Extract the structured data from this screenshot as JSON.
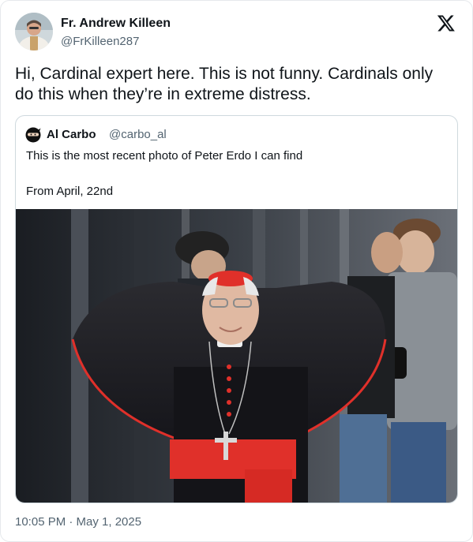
{
  "author": {
    "name": "Fr. Andrew Killeen",
    "handle": "@FrKilleen287",
    "avatar_icon": "profile-avatar"
  },
  "platform_icon": "x-logo-icon",
  "tweet": {
    "text_line1": "Hi, Cardinal expert here. This is not funny. Cardinals only",
    "text_line2": "do this when they’re in extreme distress."
  },
  "quoted_tweet": {
    "author_name": "Al Carbo",
    "author_handle": "@carbo_al",
    "avatar_icon": "ninja-avatar-icon",
    "line1": "This is the most recent photo of Peter Erdo I can find",
    "line2": "From April, 22nd",
    "photo": "cardinal-in-red-and-black-cape-photo"
  },
  "timestamp": "10:05 PM · May 1, 2025",
  "colors": {
    "text_primary": "#0f1419",
    "text_secondary": "#536471",
    "border": "#cfd9de",
    "cardinal_red": "#e0302a"
  }
}
